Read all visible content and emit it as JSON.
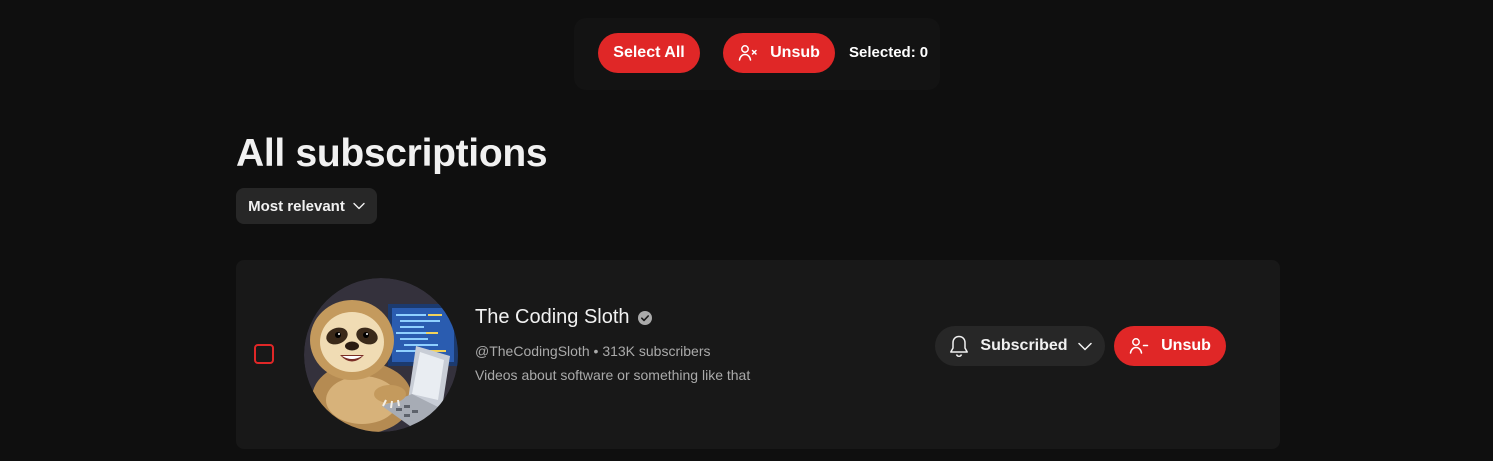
{
  "toolbar": {
    "select_all_label": "Select All",
    "unsub_label": "Unsub",
    "selected_label": "Selected:",
    "selected_count": "0"
  },
  "page": {
    "title": "All subscriptions",
    "sort_label": "Most relevant"
  },
  "channels": [
    {
      "name": "The Coding Sloth",
      "verified": true,
      "handle": "@TheCodingSloth",
      "separator": "•",
      "subscribers": "313K subscribers",
      "description": "Videos about software or something like that",
      "subscribed_label": "Subscribed",
      "unsub_label": "Unsub",
      "checked": false,
      "avatar_icon": "sloth-coding-avatar"
    }
  ],
  "colors": {
    "background": "#0f0f0f",
    "card": "#181818",
    "accent_red": "#e02727",
    "button_dark": "#272727",
    "secondary_text": "#aaaaaa"
  }
}
